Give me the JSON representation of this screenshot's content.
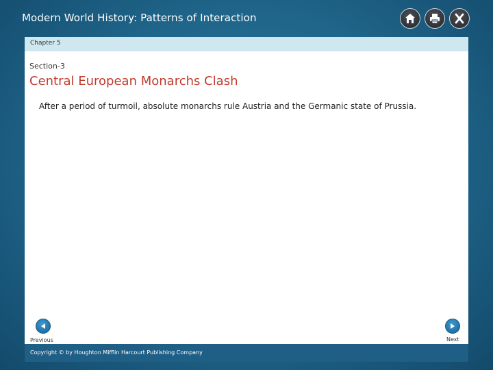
{
  "app": {
    "title": "Modern World History: Patterns of Interaction"
  },
  "toolbar": {
    "home_icon": "home-icon",
    "print_icon": "printer-icon",
    "close_icon": "close-icon"
  },
  "chapter": {
    "label": "Chapter 5"
  },
  "section": {
    "label": "Section-3"
  },
  "main": {
    "title": "Central European Monarchs Clash",
    "body": "After a period of turmoil, absolute monarchs rule Austria and the Germanic state of Prussia."
  },
  "nav": {
    "previous_label": "Previous",
    "next_label": "Next"
  },
  "footer": {
    "copyright": "Copyright © by Houghton Mifflin Harcourt Publishing Company"
  },
  "colors": {
    "frame": "#1f6489",
    "chapter_bar": "#cfe8f0",
    "title_red": "#c0392b",
    "nav_blue": "#1e6fa6"
  }
}
